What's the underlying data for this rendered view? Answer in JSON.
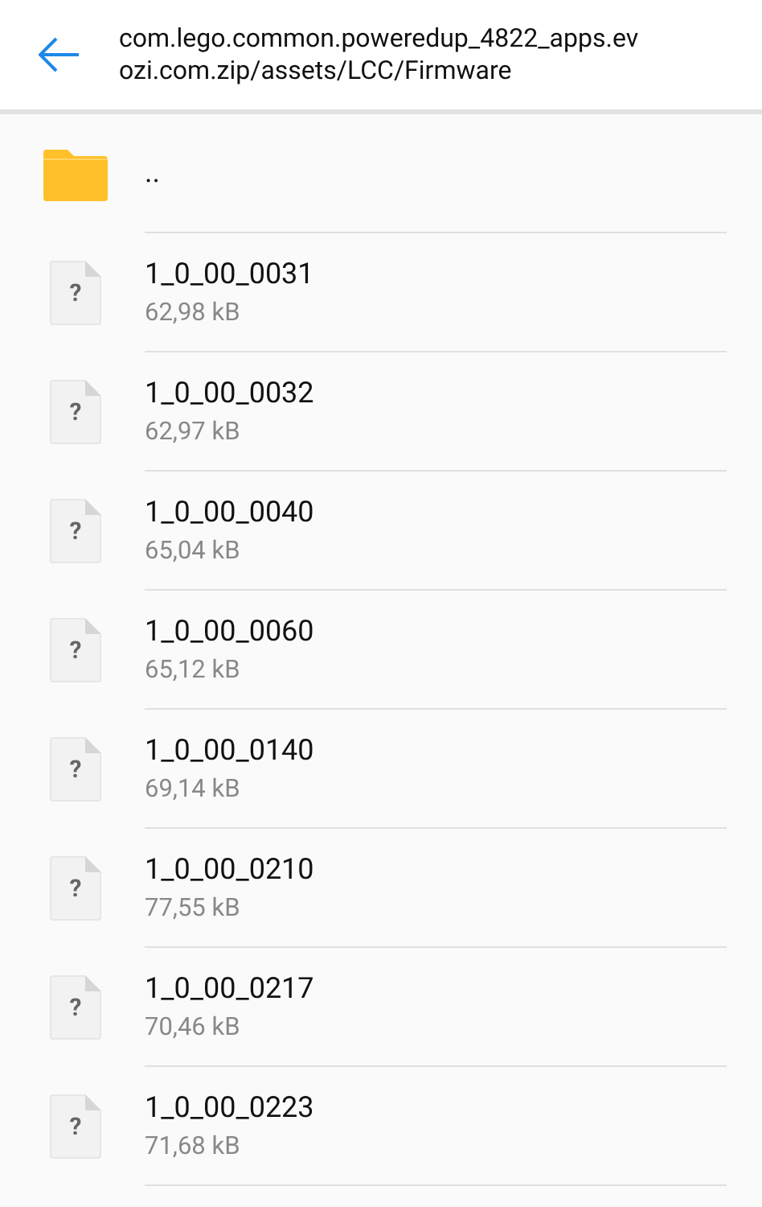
{
  "header": {
    "path": "com.lego.common.poweredup_4822_apps.evozi.com.zip/assets/LCC/Firmware"
  },
  "items": [
    {
      "kind": "folder",
      "name": ".."
    },
    {
      "kind": "file",
      "glyph": "?",
      "name": "1_0_00_0031",
      "size": "62,98 kB"
    },
    {
      "kind": "file",
      "glyph": "?",
      "name": "1_0_00_0032",
      "size": "62,97 kB"
    },
    {
      "kind": "file",
      "glyph": "?",
      "name": "1_0_00_0040",
      "size": "65,04 kB"
    },
    {
      "kind": "file",
      "glyph": "?",
      "name": "1_0_00_0060",
      "size": "65,12 kB"
    },
    {
      "kind": "file",
      "glyph": "?",
      "name": "1_0_00_0140",
      "size": "69,14 kB"
    },
    {
      "kind": "file",
      "glyph": "?",
      "name": "1_0_00_0210",
      "size": "77,55 kB"
    },
    {
      "kind": "file",
      "glyph": "?",
      "name": "1_0_00_0217",
      "size": "70,46 kB"
    },
    {
      "kind": "file",
      "glyph": "?",
      "name": "1_0_00_0223",
      "size": "71,68 kB"
    }
  ]
}
